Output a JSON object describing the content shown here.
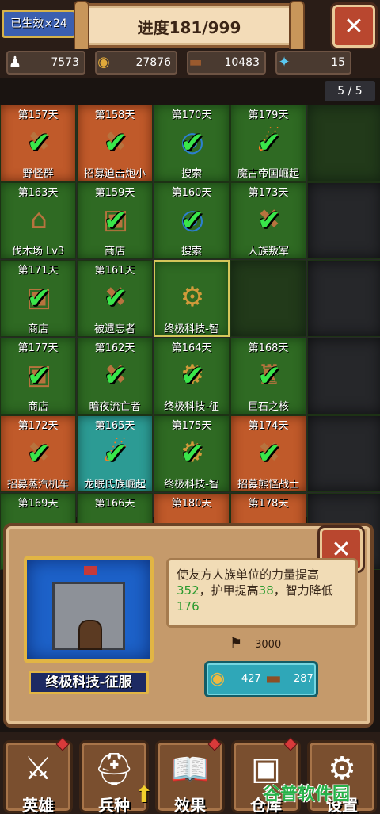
{
  "header": {
    "effect_badge": "已生效×24",
    "progress": "进度181/999",
    "close_label": "✕"
  },
  "resources": [
    {
      "icon": "population-icon",
      "glyph": "♟",
      "value": "7573"
    },
    {
      "icon": "gold-coins-icon",
      "glyph": "◉",
      "value": "27876"
    },
    {
      "icon": "wood-logs-icon",
      "glyph": "▬",
      "value": "10483"
    },
    {
      "icon": "crystal-key-icon",
      "glyph": "✦",
      "value": "15"
    }
  ],
  "pager": "5 / 5",
  "tiles": [
    {
      "day": "第157天",
      "name": "野怪群",
      "terrain": "lava",
      "icon": "monster-pack-icon",
      "glyph": "✖",
      "done": true
    },
    {
      "day": "第158天",
      "name": "招募迫击炮小",
      "terrain": "lava",
      "icon": "mortar-recruit-icon",
      "glyph": "✖",
      "done": true
    },
    {
      "day": "第170天",
      "name": "搜索",
      "terrain": "forest",
      "icon": "telescope-icon",
      "glyph": "◎",
      "done": true
    },
    {
      "day": "第179天",
      "name": "魔古帝国崛起",
      "terrain": "forest",
      "icon": "meteor-icon",
      "glyph": "☄",
      "done": true
    },
    {
      "day": "",
      "name": "",
      "terrain": "empty",
      "icon": "",
      "glyph": "",
      "done": false
    },
    {
      "day": "第163天",
      "name": "伐木场 Lv3",
      "terrain": "forest",
      "icon": "lumber-mill-icon",
      "glyph": "⌂",
      "done": false
    },
    {
      "day": "第159天",
      "name": "商店",
      "terrain": "forest",
      "icon": "shop-chest-icon",
      "glyph": "▣",
      "done": true
    },
    {
      "day": "第160天",
      "name": "搜索",
      "terrain": "forest",
      "icon": "telescope-icon",
      "glyph": "◎",
      "done": true
    },
    {
      "day": "第173天",
      "name": "人族叛军",
      "terrain": "forest",
      "icon": "rebel-icon",
      "glyph": "✖",
      "done": true
    },
    {
      "day": "",
      "name": "",
      "terrain": "dark",
      "icon": "",
      "glyph": "",
      "done": false
    },
    {
      "day": "第171天",
      "name": "商店",
      "terrain": "forest",
      "icon": "shop-chest-icon",
      "glyph": "▣",
      "done": true
    },
    {
      "day": "第161天",
      "name": "被遗忘者",
      "terrain": "forest",
      "icon": "forgotten-icon",
      "glyph": "✖",
      "done": true
    },
    {
      "day": "",
      "name": "终极科技-智",
      "terrain": "forest",
      "icon": "gear-tech-icon",
      "glyph": "⚙",
      "done": false,
      "selected": true
    },
    {
      "day": "",
      "name": "",
      "terrain": "empty",
      "icon": "",
      "glyph": "",
      "done": false
    },
    {
      "day": "",
      "name": "",
      "terrain": "dark",
      "icon": "",
      "glyph": "",
      "done": false
    },
    {
      "day": "第177天",
      "name": "商店",
      "terrain": "forest",
      "icon": "shop-chest-icon",
      "glyph": "▣",
      "done": true
    },
    {
      "day": "第162天",
      "name": "暗夜流亡者",
      "terrain": "forest",
      "icon": "night-exile-icon",
      "glyph": "✖",
      "done": true
    },
    {
      "day": "第164天",
      "name": "终极科技-征",
      "terrain": "forest",
      "icon": "gear-tech-icon",
      "glyph": "⚙",
      "done": true
    },
    {
      "day": "第168天",
      "name": "巨石之核",
      "terrain": "forest",
      "icon": "stone-core-icon",
      "glyph": "♜",
      "done": true
    },
    {
      "day": "",
      "name": "",
      "terrain": "dark",
      "icon": "",
      "glyph": "",
      "done": false
    },
    {
      "day": "第172天",
      "name": "招募蒸汽机车",
      "terrain": "lava",
      "icon": "steam-engine-icon",
      "glyph": "✖",
      "done": true
    },
    {
      "day": "第165天",
      "name": "龙眠氏族崛起",
      "terrain": "water",
      "icon": "meteor-icon",
      "glyph": "☄",
      "done": true
    },
    {
      "day": "第175天",
      "name": "终极科技-智",
      "terrain": "forest",
      "icon": "gear-tech-icon",
      "glyph": "⚙",
      "done": true
    },
    {
      "day": "第174天",
      "name": "招募熊怪战士",
      "terrain": "lava",
      "icon": "bear-warrior-icon",
      "glyph": "✖",
      "done": true
    },
    {
      "day": "",
      "name": "",
      "terrain": "dark",
      "icon": "",
      "glyph": "",
      "done": false
    },
    {
      "day": "第169天",
      "name": "",
      "terrain": "forest",
      "icon": "",
      "glyph": "",
      "done": false
    },
    {
      "day": "第166天",
      "name": "",
      "terrain": "forest",
      "icon": "",
      "glyph": "",
      "done": false
    },
    {
      "day": "第180天",
      "name": "",
      "terrain": "lava",
      "icon": "",
      "glyph": "",
      "done": false
    },
    {
      "day": "第178天",
      "name": "",
      "terrain": "lava",
      "icon": "",
      "glyph": "",
      "done": false
    },
    {
      "day": "",
      "name": "",
      "terrain": "dark",
      "icon": "",
      "glyph": "",
      "done": false
    }
  ],
  "detail": {
    "title": "终极科技-征服",
    "desc_1": "使友方人族单位的力量提高",
    "val_strength": "352",
    "desc_2": "，护甲提高",
    "val_armor": "38",
    "desc_3": "，智力降低",
    "val_int": "176",
    "unlock_value": "3000",
    "cost_gold": "427",
    "cost_wood": "287",
    "close_label": "✕"
  },
  "nav": [
    {
      "label": "英雄",
      "icon": "sword-icon",
      "glyph": "⚔",
      "alert": true
    },
    {
      "label": "兵种",
      "icon": "knight-helmet-icon",
      "glyph": "⛑",
      "alert": false
    },
    {
      "label": "效果",
      "icon": "spellbook-icon",
      "glyph": "📖",
      "alert": true
    },
    {
      "label": "仓库",
      "icon": "treasure-chest-icon",
      "glyph": "▣",
      "alert": true
    },
    {
      "label": "设置",
      "icon": "gear-settings-icon",
      "glyph": "⚙",
      "alert": false
    }
  ],
  "watermark": "谷普软件园"
}
